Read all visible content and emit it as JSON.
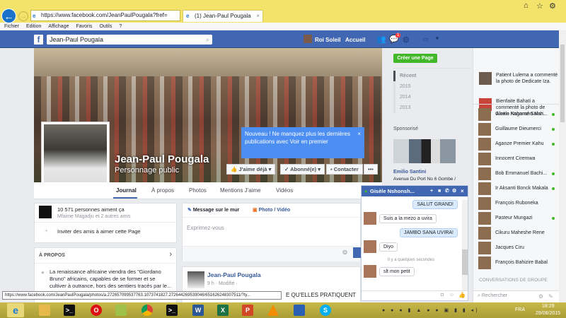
{
  "browser": {
    "url": "https://www.facebook.com/JeanPaulPougala?fref=",
    "tab_title": "(1) Jean-Paul Pougala",
    "menu": [
      "Fichier",
      "Edition",
      "Affichage",
      "Favoris",
      "Outils",
      "?"
    ]
  },
  "fbbar": {
    "search_value": "Jean-Paul Pougala",
    "user": "Roi Soleil",
    "home": "Accueil",
    "notif_count": "1"
  },
  "profile": {
    "name": "Jean-Paul Pougala",
    "category": "Personnage public",
    "like_btn": "J'aime déjà",
    "follow_btn": "Abonné(e)",
    "contact_btn": "Contacter",
    "more_btn": "•••",
    "tip": "Nouveau ! Ne manquez plus les dernières publications avec Voir en premier",
    "tabs": [
      "Journal",
      "À propos",
      "Photos",
      "Mentions J'aime",
      "Vidéos"
    ]
  },
  "likes": {
    "count": "10 571 personnes aiment ça",
    "friends": "Mfaime Magadju et 2 autres amis",
    "invite": "Inviter des amis à aimer cette Page"
  },
  "about": {
    "title": "À PROPOS",
    "text": "La renaissance africaine viendra des \"Giordano Bruno\" africains, capables de se former et se cultiver à outrance, hors des sentiers tracés par le..."
  },
  "composer": {
    "tab1": "Message sur le mur",
    "tab2": "Photo / Vidéo",
    "placeholder": "Exprimez-vous"
  },
  "post": {
    "author": "Jean-Paul Pougala",
    "meta": "9 h · Modifié ·",
    "text_partial": "E QU'ELLES PRATIQUENT"
  },
  "right": {
    "create_page": "Créer une Page",
    "years": [
      "Récent",
      "2015",
      "2014",
      "2013"
    ],
    "sponsored": "Sponsorisé",
    "ad_name": "Emilio Santini",
    "ad_text": "Avenue Du Port No 6 Gombe /"
  },
  "ticker": [
    {
      "text": "Patient Lulema a commenté la photo de Dedicate Iza."
    },
    {
      "text": "Bienfaite Bahati a commenté la photo de Alexis Kagame Safari."
    }
  ],
  "friends": [
    {
      "name": "Gisèle Nshonsho Nsh...",
      "online": true
    },
    {
      "name": "Guillaume Dieumerci",
      "online": true
    },
    {
      "name": "Aganze Premier Kahu",
      "online": true
    },
    {
      "name": "Innocent Ciremwa",
      "online": false
    },
    {
      "name": "Bob Emmanuel Bachi...",
      "online": true
    },
    {
      "name": "Ir Aksanti Bonck Makala",
      "online": true
    },
    {
      "name": "François Ruboneka",
      "online": false
    },
    {
      "name": "Pasteur Mungazi",
      "online": true
    },
    {
      "name": "Cikuru Maheshe Rene",
      "online": false
    },
    {
      "name": "Jacques Ciru",
      "online": false
    },
    {
      "name": "François Bahizire Babal",
      "online": false
    }
  ],
  "group_conv": "CONVERSATIONS DE GROUPE",
  "chat_search": "Rechercher",
  "chat": {
    "name": "Gisèle Nshonsh...",
    "messages": [
      {
        "from": "me",
        "text": "SALUT GRAND!"
      },
      {
        "from": "them",
        "text": "Suis a la mezo a uvira"
      },
      {
        "from": "me",
        "text": "JAMBO SANA UVIRA!"
      },
      {
        "from": "them",
        "text": "Diyo"
      },
      {
        "from": "them",
        "text": "slt mon petit"
      }
    ],
    "separator": "Il y a quelques secondes"
  },
  "status_url": "https://www.facebook.com/JeanPaulPougala/photos/a.272657099537763.1073741827.272644269539046/651626248307511/?ty...",
  "taskbar": {
    "lang": "FRA",
    "time": "18:29",
    "date": "29/08/2015"
  },
  "colors": {
    "fb_blue": "#4267b2",
    "green": "#42b72a",
    "taskbar": "#b8aa40"
  }
}
